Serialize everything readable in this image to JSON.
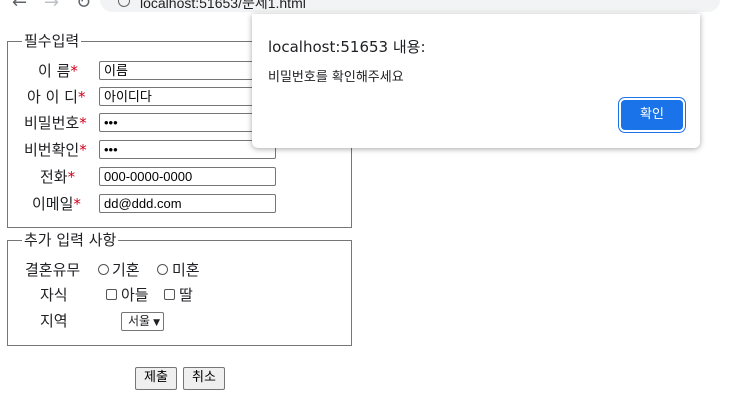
{
  "browser": {
    "url": "localhost:51653/문제1.html"
  },
  "form": {
    "required": {
      "legend": "필수입력",
      "fields": [
        {
          "label": "이 름",
          "value": "이름"
        },
        {
          "label": "아 이 디",
          "value": "아이디다"
        },
        {
          "label": "비밀번호",
          "value": "•••"
        },
        {
          "label": "비번확인",
          "value": "•••"
        },
        {
          "label": "전화",
          "value": "000-0000-0000"
        },
        {
          "label": "이메일",
          "value": "dd@ddd.com"
        }
      ],
      "required_mark": "*"
    },
    "extra": {
      "legend": "추가 입력 사항",
      "marital_label": "결혼유무",
      "marital_options": [
        "기혼",
        "미혼"
      ],
      "children_label": "자식",
      "children_options": [
        "아들",
        "딸"
      ],
      "region_label": "지역",
      "region_selected": "서울"
    },
    "submit_label": "제출",
    "cancel_label": "취소"
  },
  "dialog": {
    "title": "localhost:51653 내용:",
    "message": "비밀번호를 확인해주세요",
    "ok_label": "확인",
    "accent": "#1a73e8"
  }
}
